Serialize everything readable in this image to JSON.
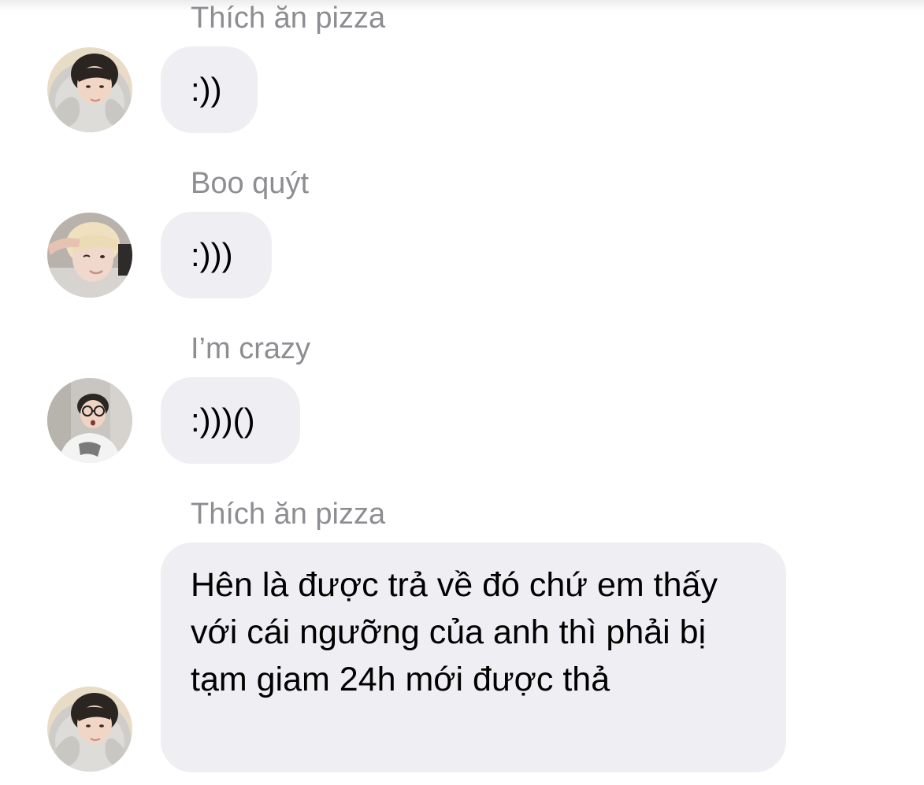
{
  "chat": {
    "messages": [
      {
        "sender": "Thích ăn pizza",
        "text": ":))",
        "avatar_icon": "avatar-hoodie-boy-icon"
      },
      {
        "sender": "Boo quýt",
        "text": ":)))",
        "avatar_icon": "avatar-blonde-boy-icon"
      },
      {
        "sender": "I’m crazy",
        "text": ":)))()",
        "avatar_icon": "avatar-glasses-boy-icon"
      },
      {
        "sender": "Thích ăn pizza",
        "text": "Hên là được trả về đó chứ em thấy với cái ngưỡng của anh thì phải bị tạm giam 24h mới được thả",
        "avatar_icon": "avatar-hoodie-boy-icon"
      }
    ]
  },
  "colors": {
    "bubble_background": "#efeff3",
    "sender_text": "#8d8d92",
    "message_text": "#000000"
  }
}
